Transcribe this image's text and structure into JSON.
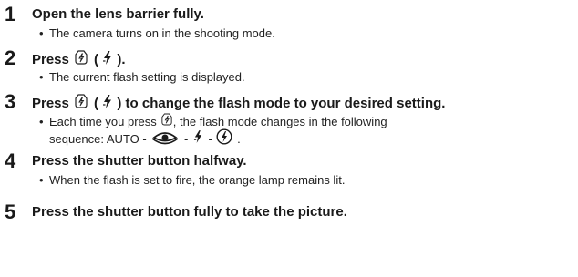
{
  "steps": [
    {
      "number": "1",
      "title": "Open the lens barrier fully.",
      "bullet": "•",
      "note": "The camera turns on in the shooting mode."
    },
    {
      "number": "2",
      "title_a": "Press",
      "title_b": " ( ",
      "title_c": " ).",
      "bullet": "•",
      "note": "The current flash setting is displayed."
    },
    {
      "number": "3",
      "title_a": "Press",
      "title_b": " ( ",
      "title_c": " ) to change the flash mode to your desired setting.",
      "bullet": "•",
      "note_a": "Each time you press",
      "note_b": ", the flash mode changes in the following",
      "note_line2_a": "sequence: AUTO - ",
      "sep": " - ",
      "note_line2_end": " ."
    },
    {
      "number": "4",
      "title": "Press the shutter button halfway.",
      "bullet": "•",
      "note": "When the flash is set to fire, the orange lamp remains lit."
    },
    {
      "number": "5",
      "title": "Press the shutter button fully to take the picture."
    }
  ],
  "icons": {
    "flash_button": "flash-button-icon",
    "flash": "flash-icon",
    "red_eye": "red-eye-reduction-icon",
    "flash_fill": "fill-in-flash-icon"
  }
}
